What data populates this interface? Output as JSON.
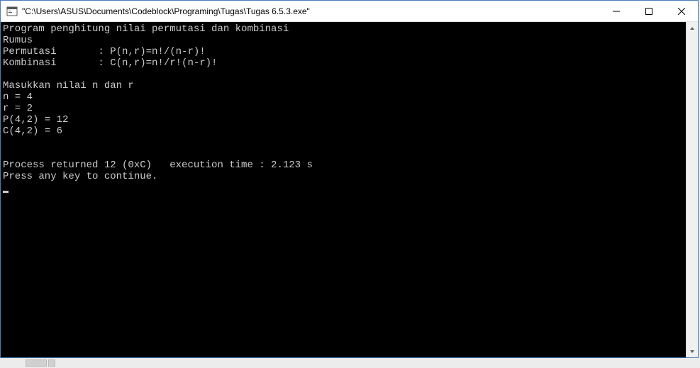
{
  "titlebar": {
    "title": "\"C:\\Users\\ASUS\\Documents\\Codeblock\\Programing\\Tugas\\Tugas 6.5.3.exe\""
  },
  "console": {
    "lines": [
      "Program penghitung nilai permutasi dan kombinasi",
      "Rumus",
      "Permutasi       : P(n,r)=n!/(n-r)!",
      "Kombinasi       : C(n,r)=n!/r!(n-r)!",
      "",
      "Masukkan nilai n dan r",
      "n = 4",
      "r = 2",
      "P(4,2) = 12",
      "C(4,2) = 6",
      "",
      "",
      "Process returned 12 (0xC)   execution time : 2.123 s",
      "Press any key to continue."
    ]
  }
}
